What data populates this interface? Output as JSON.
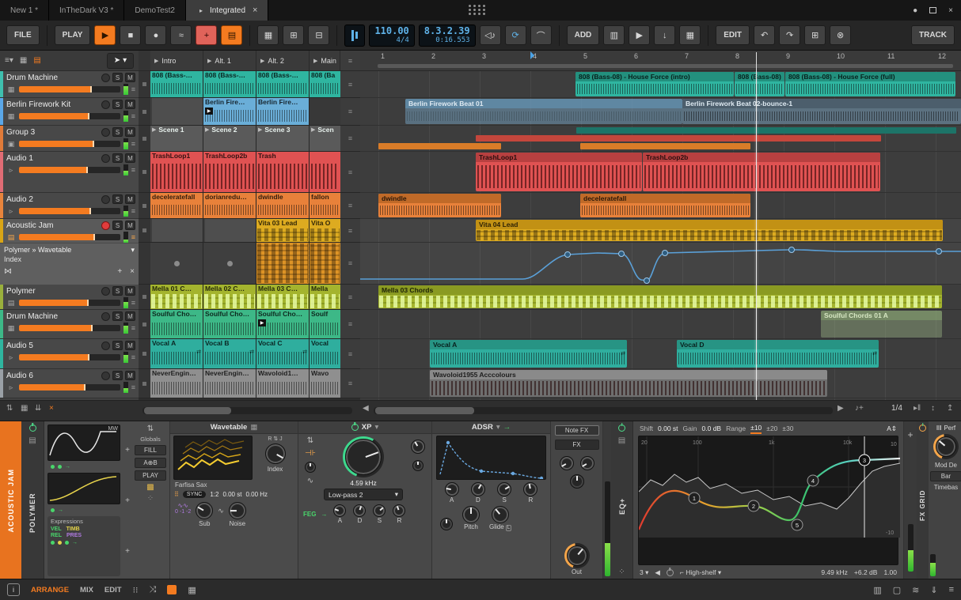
{
  "colors": {
    "accent_orange": "#f47b20",
    "lcd_blue": "#5fb2e8",
    "clip_teal": "#2fb5a0",
    "clip_blue": "#6aaed8",
    "clip_red": "#e05252",
    "clip_orange": "#e8813a",
    "clip_yellow": "#ddab20",
    "clip_olive": "#a4b42e",
    "clip_green": "#3db887",
    "clip_vocal": "#2fae9e",
    "clip_gray": "#8f8f8f",
    "meter_green": "#4cc94c"
  },
  "icons": {
    "play": "▶",
    "stop": "■",
    "record": "●",
    "menu": "≡",
    "close": "×",
    "chevron": "▾",
    "undo": "↶",
    "redo": "↷",
    "delete": "⊗",
    "loop": "⟳",
    "note": "♪",
    "grid": "▦",
    "bars": "▤",
    "plus": "+"
  },
  "tab_bar": {
    "tabs": [
      {
        "label": "New 1 *"
      },
      {
        "label": "InTheDark V3 *"
      },
      {
        "label": "DemoTest2"
      },
      {
        "label": "Integrated"
      }
    ]
  },
  "toolbar": {
    "file": "FILE",
    "play": "PLAY",
    "tempo": "110.00",
    "time_sig": "4/4",
    "position": "8.3.2.39",
    "time": "0:16.553",
    "add": "ADD",
    "edit": "EDIT",
    "track": "TRACK"
  },
  "tracks": [
    {
      "name": "Drum Machine"
    },
    {
      "name": "Berlin Firework Kit"
    },
    {
      "name": "Group 3"
    },
    {
      "name": "Audio 1"
    },
    {
      "name": "Audio 2"
    },
    {
      "name": "Acoustic Jam"
    },
    {
      "name": "Polymer"
    },
    {
      "name": "Drum Machine"
    },
    {
      "name": "Audio 5"
    },
    {
      "name": "Audio 6"
    }
  ],
  "track_controls": {
    "solo": "S",
    "mute": "M"
  },
  "device_chooser": {
    "device": "Polymer » Wavetable",
    "param": "Index"
  },
  "scenes": [
    {
      "name": "Intro"
    },
    {
      "name": "Alt. 1"
    },
    {
      "name": "Alt. 2"
    },
    {
      "name": "Main"
    }
  ],
  "launcher": {
    "rows": [
      {
        "clips": [
          "808 (Bass-…",
          "808 (Bass-…",
          "808 (Bass-…",
          "808 (Ba"
        ]
      },
      {
        "clips": [
          "",
          "Berlin Fire…",
          "Berlin Fire…",
          ""
        ]
      },
      {
        "clips": [
          "Scene 1",
          "Scene 2",
          "Scene 3",
          "Scen"
        ]
      },
      {
        "clips": [
          "TrashLoop1",
          "TrashLoop2b",
          "Trash",
          ""
        ]
      },
      {
        "clips": [
          "deceleratefall",
          "dorianredu…",
          "dwindle",
          "fallon"
        ]
      },
      {
        "clips": [
          "",
          "",
          "Vita 03 Lead",
          "Vita O"
        ]
      },
      {
        "clips": [
          "Mella 01 C…",
          "Mella 02 C…",
          "Mella 03 C…",
          "Mella"
        ]
      },
      {
        "clips": [
          "Soulful Cho…",
          "Soulful Cho…",
          "Soulful Cho…",
          "Soulf"
        ]
      },
      {
        "clips": [
          "Vocal A",
          "Vocal B",
          "Vocal C",
          "Vocal"
        ]
      },
      {
        "clips": [
          "NeverEngin…",
          "NeverEngin…",
          "Wavoloid1…",
          "Wavo"
        ]
      }
    ]
  },
  "arranger": {
    "beats": [
      "1",
      "2",
      "3",
      "4",
      "5",
      "6",
      "7",
      "8",
      "9",
      "10",
      "11",
      "12"
    ],
    "row_drum1": {
      "c1": "808 (Bass-08) - House Force (intro)",
      "c2": "808 (Bass-08)",
      "c3": "808 (Bass-08) - House Force (full)"
    },
    "row_berlin": {
      "c1": "Berlin Firework Beat 01",
      "c2": "Berlin Firework Beat 02-bounce-1"
    },
    "row_audio1": {
      "c1": "TrashLoop1",
      "c2": "TrashLoop2b"
    },
    "row_audio2": {
      "c1": "dwindle",
      "c2": "deceleratefall"
    },
    "row_jam": {
      "c1": "Vita 04 Lead"
    },
    "row_polymer": {
      "c1": "Mella 03 Chords"
    },
    "row_drum2": {
      "c1": "Soulful Chords 01 A"
    },
    "row_audio5": {
      "c1": "Vocal A",
      "c2": "Vocal D"
    },
    "row_audio6": {
      "c1": "Wavoloid1955 Acccolours"
    },
    "grid_value": "1/4"
  },
  "device": {
    "track": "ACOUSTIC JAM",
    "polymer": {
      "name": "POLYMER",
      "mw": "MW",
      "globals": "Globals",
      "fill": "FILL",
      "ab": "A⊕B",
      "play": "PLAY",
      "expressions": "Expressions",
      "vel": "VEL",
      "timb": "TIMB",
      "rel": "REL",
      "pres": "PRES"
    },
    "wavetable": {
      "title": "Wavetable",
      "preset": "Farfisa Sax",
      "index_label": "Index",
      "sync": "SYNC",
      "ratio": "1:2",
      "detune": "0.00 st",
      "freq": "0.00 Hz",
      "sub": "Sub",
      "zero": "0",
      "minus1": "-1",
      "minus2": "-2",
      "noise": "Noise"
    },
    "filter": {
      "title": "XP",
      "cutoff": "4.59 kHz",
      "mode": "Low-pass 2",
      "feg": "FEG",
      "a": "A",
      "d": "D",
      "s": "S",
      "r": "R"
    },
    "env": {
      "title": "ADSR",
      "a": "A",
      "d": "D",
      "s": "S",
      "r": "R",
      "pitch": "Pitch",
      "glide": "Glide",
      "glide_tag": "L"
    },
    "fx": {
      "note_fx": "Note FX",
      "fx": "FX",
      "out": "Out"
    },
    "eq": {
      "name": "EQ+",
      "shift_label": "Shift",
      "shift": "0.00 st",
      "gain_label": "Gain",
      "gain": "0.0 dB",
      "range_label": "Range",
      "r10": "±10",
      "r20": "±20",
      "r30": "±30",
      "f20": "20",
      "f100": "100",
      "f1k": "1k",
      "f10k": "10k",
      "p10": "10",
      "m10": "-10",
      "bands": "3",
      "type": "High-shelf",
      "freq": "9.49 kHz",
      "band_gain": "+6.2 dB",
      "q": "1.00",
      "n1": "1",
      "n2": "2",
      "n3": "3",
      "n4": "4",
      "n5": "5",
      "ab": "A"
    },
    "fxgrid": {
      "name": "FX GRID",
      "perf": "Perf",
      "mod": "Mod De",
      "bar": "Bar",
      "timebase": "Timebas"
    }
  },
  "status_bar": {
    "arrange": "ARRANGE",
    "mix": "MIX",
    "edit": "EDIT",
    "info": "i"
  }
}
